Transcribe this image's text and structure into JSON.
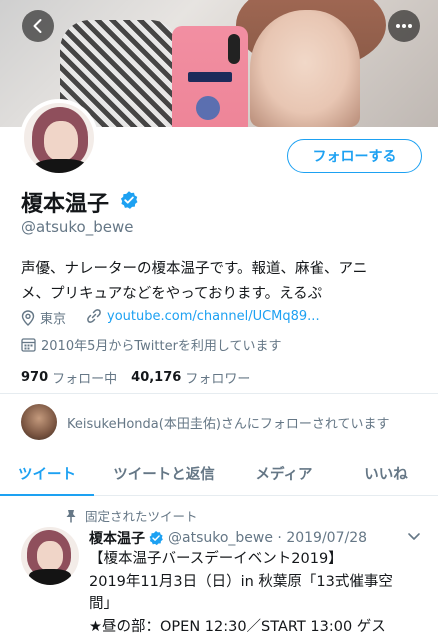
{
  "profile": {
    "display_name": "榎本温子",
    "handle": "@atsuko_bewe",
    "follow_label": "フォローする",
    "bio_line1": "声優、ナレーターの榎本温子です。報道、麻雀、アニ",
    "bio_line2": "メ、プリキュアなどをやっております。えるぷ",
    "location": "東京",
    "link": "youtube.com/channel/UCMq89...",
    "joined": "2010年5月からTwitterを利用しています",
    "following_count": "970",
    "following_label": "フォロー中",
    "followers_count": "40,176",
    "followers_label": "フォロワー",
    "followed_by": "KeisukeHonda(本田圭佑)さんにフォローされています"
  },
  "tabs": [
    {
      "label": "ツイート"
    },
    {
      "label": "ツイートと返信"
    },
    {
      "label": "メディア"
    },
    {
      "label": "いいね"
    }
  ],
  "pinned_tweet": {
    "pinned_label": "固定されたツイート",
    "author": "榎本温子",
    "meta": "@atsuko_bewe · 2019/07/28",
    "text": "【榎本温子バースデーイベント2019】\n2019年11月3日（日）in 秋葉原「13式催事空\n間」\n★昼の部：OPEN 12:30／START 13:00 ゲス"
  },
  "icons": {
    "back": "arrow-left-icon",
    "more": "more-horizontal-icon",
    "verified": "verified-badge-icon",
    "location": "location-pin-icon",
    "link": "link-icon",
    "calendar": "calendar-icon",
    "pin": "pin-icon",
    "caret": "chevron-down-icon"
  },
  "colors": {
    "accent": "#1da1f2",
    "secondary_text": "#657786",
    "primary_text": "#14171a",
    "divider": "#e6ecf0"
  }
}
